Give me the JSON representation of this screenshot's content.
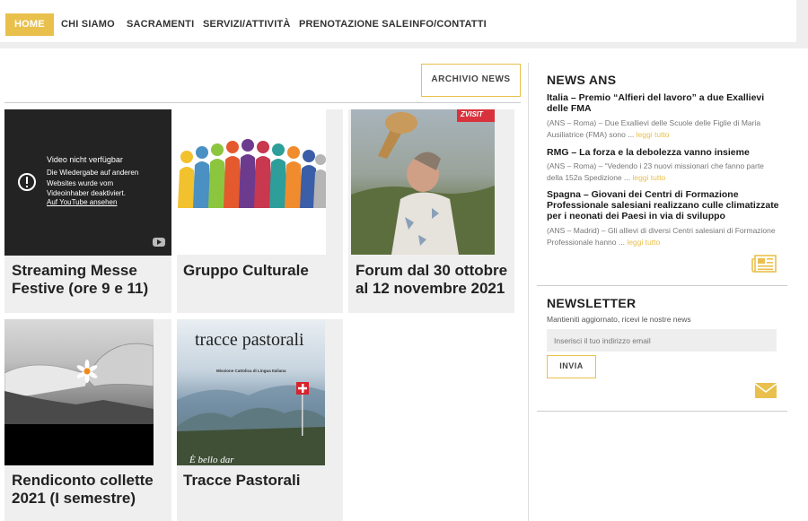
{
  "nav": {
    "items": [
      {
        "label": "HOME",
        "active": true
      },
      {
        "label": "CHI SIAMO"
      },
      {
        "label": "SACRAMENTI"
      },
      {
        "label": "SERVIZI/ATTIVITÀ"
      },
      {
        "label": "PRENOTAZIONE SALE"
      },
      {
        "label": "INFO/CONTATTI"
      }
    ]
  },
  "main": {
    "archive_label": "ARCHIVIO NEWS",
    "cards": [
      {
        "title": "Streaming Messe Festive (ore 9 e 11)"
      },
      {
        "title": "Gruppo Culturale"
      },
      {
        "title": "Forum dal 30 ottobre al 12 novembre 2021"
      },
      {
        "title": "Rendiconto collette 2021 (I semestre)"
      },
      {
        "title": "Tracce Pastorali"
      }
    ],
    "video": {
      "title": "Video nicht verfügbar",
      "message": "Die Wiedergabe auf anderen Websites wurde vom Videoinhaber deaktiviert.",
      "link": "Auf YouTube ansehen"
    },
    "magazine": {
      "title": "tracce pastorali",
      "subtitle": "Missione Cattolica di Lingua Italiana",
      "caption": "È bello dar"
    },
    "forum_badge": "ZVISIT"
  },
  "sidebar": {
    "news_heading": "NEWS ANS",
    "news": [
      {
        "title": "Italia – Premio “Alfieri del lavoro” a due Exallievi delle FMA",
        "excerpt": "(ANS – Roma) – Due Exallievi delle Scuole delle Figlie di Maria Ausiliatrice (FMA) sono ... ",
        "more": "leggi tutto"
      },
      {
        "title": "RMG – La forza e la debolezza vanno insieme",
        "excerpt": "(ANS – Roma) – “Vedendo i 23 nuovi missionari che fanno parte della 152a Spedizione ... ",
        "more": "leggi tutto"
      },
      {
        "title": "Spagna – Giovani dei Centri di Formazione Professionale salesiani realizzano culle climatizzate per i neonati dei Paesi in via di sviluppo",
        "excerpt": "(ANS – Madrid) – Gli allievi di diversi Centri salesiani di Formazione Professionale hanno ... ",
        "more": "leggi tutto"
      }
    ],
    "newsletter_heading": "NEWSLETTER",
    "newsletter_text": "Mantieniti aggiornato, ricevi le nostre news",
    "email_placeholder": "Inserisci il tuo indirizzo email",
    "send_label": "INVIA"
  },
  "colors": {
    "accent": "#e9c04c",
    "page_bg": "#eeeeee",
    "card_bg": "#efefef"
  }
}
